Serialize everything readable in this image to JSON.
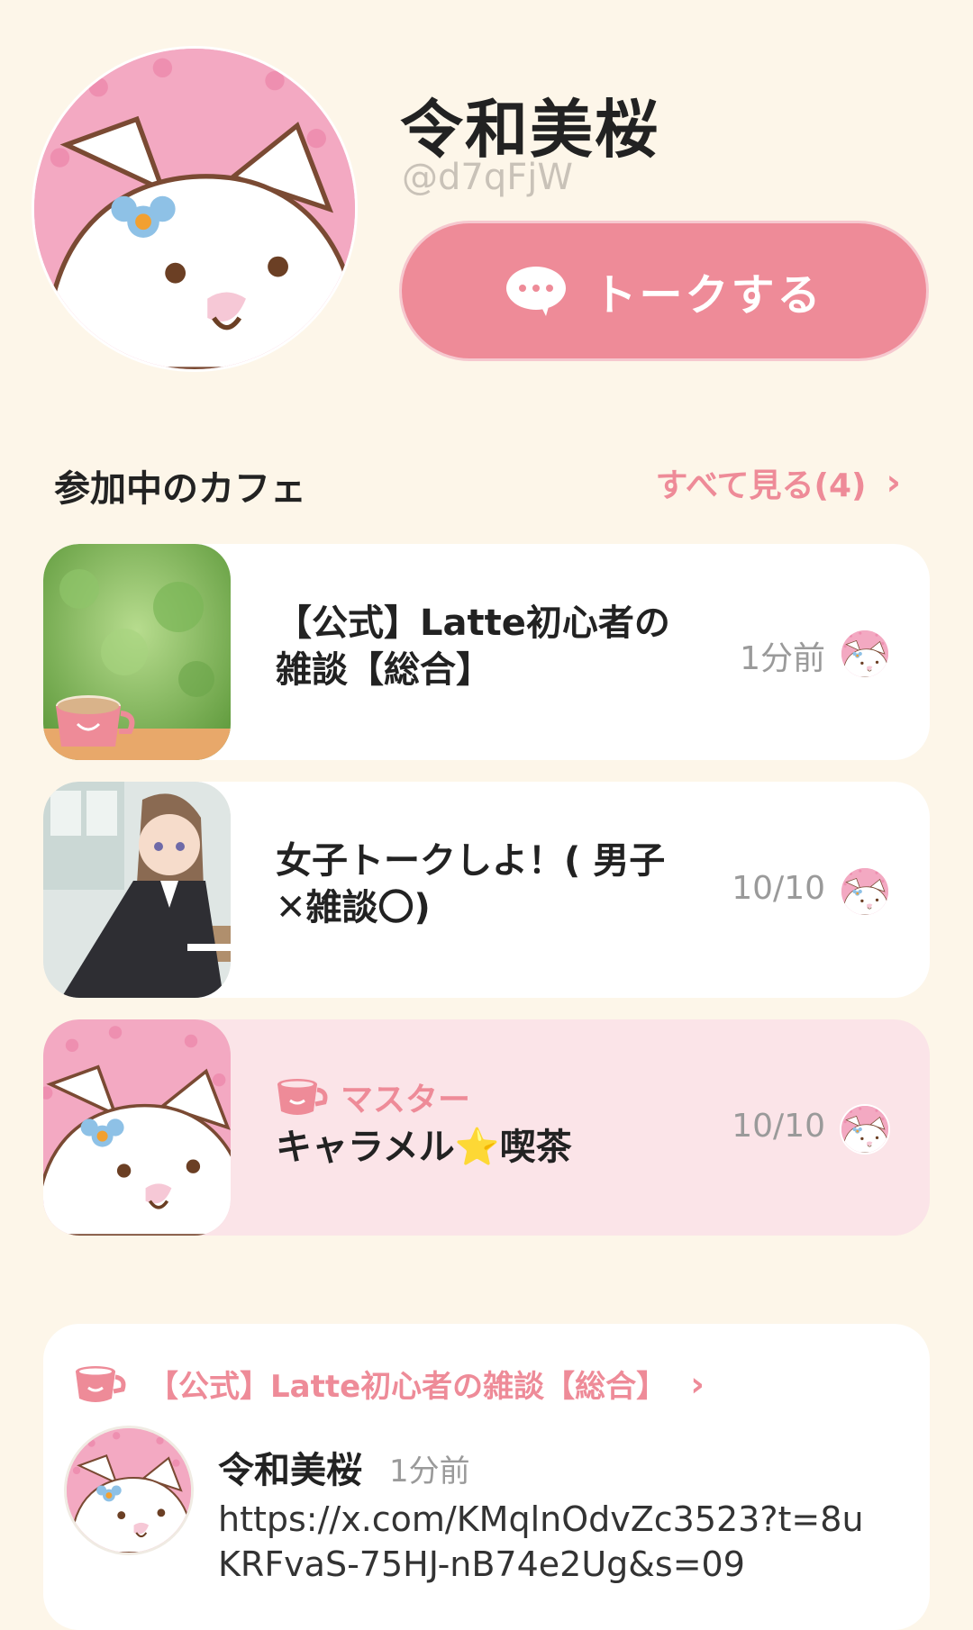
{
  "profile": {
    "display_name": "令和美桜",
    "handle": "@d7qFjW",
    "talk_button_label": "トークする"
  },
  "cafes_section": {
    "title": "参加中のカフェ",
    "see_all_label": "すべて見る(4)",
    "cafes": [
      {
        "title": "【公式】Latte初心者の雑談【総合】",
        "time": "1分前"
      },
      {
        "title": "女子トークしよ！( 男子✕雑談〇)",
        "time": "10/10"
      },
      {
        "role": "マスター",
        "title": "キャラメル⭐喫茶",
        "time": "10/10"
      }
    ]
  },
  "recent_post": {
    "cafe_name": "【公式】Latte初心者の雑談【総合】",
    "author": "令和美桜",
    "time": "1分前",
    "body": "https://x.com/KMqlnOdvZc3523?t=8uKRFvaS-75HJ-nB74e2Ug&s=09"
  },
  "colors": {
    "accent": "#ee8b98",
    "background": "#fdf6e9",
    "card": "#ffffff",
    "card_highlight": "#fbe4e8"
  },
  "icons": [
    "chat-bubble-icon",
    "chevron-right-icon",
    "coffee-cup-icon"
  ]
}
